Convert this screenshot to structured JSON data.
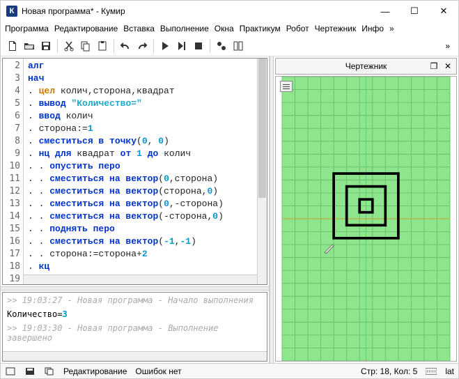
{
  "window": {
    "title": "Новая программа* - Кумир",
    "icon_letter": "К"
  },
  "menu": {
    "items": [
      "Программа",
      "Редактирование",
      "Вставка",
      "Выполнение",
      "Окна",
      "Практикум",
      "Робот",
      "Чертежник",
      "Инфо",
      "»"
    ]
  },
  "toolbar": {
    "more": "»"
  },
  "editor": {
    "first_line": 2,
    "lines": [
      {
        "n": 2,
        "seg": [
          {
            "t": "алг",
            "c": "kw"
          }
        ]
      },
      {
        "n": 3,
        "seg": [
          {
            "t": "нач",
            "c": "kw"
          }
        ]
      },
      {
        "n": 4,
        "seg": [
          {
            "t": ". ",
            "c": "id"
          },
          {
            "t": "цел",
            "c": "ty"
          },
          {
            "t": " колич,сторона,квадрат",
            "c": "id"
          }
        ]
      },
      {
        "n": 5,
        "seg": [
          {
            "t": ". ",
            "c": "id"
          },
          {
            "t": "вывод",
            "c": "kw"
          },
          {
            "t": " ",
            "c": "id"
          },
          {
            "t": "\"Количество=\"",
            "c": "str"
          }
        ]
      },
      {
        "n": 6,
        "seg": [
          {
            "t": ". ",
            "c": "id"
          },
          {
            "t": "ввод",
            "c": "kw"
          },
          {
            "t": " колич",
            "c": "id"
          }
        ]
      },
      {
        "n": 7,
        "seg": [
          {
            "t": ". сторона:=",
            "c": "id"
          },
          {
            "t": "1",
            "c": "num"
          }
        ]
      },
      {
        "n": 8,
        "seg": [
          {
            "t": ". ",
            "c": "id"
          },
          {
            "t": "сместиться в точку",
            "c": "kw"
          },
          {
            "t": "(",
            "c": "id"
          },
          {
            "t": "0",
            "c": "num"
          },
          {
            "t": ", ",
            "c": "id"
          },
          {
            "t": "0",
            "c": "num"
          },
          {
            "t": ")",
            "c": "id"
          }
        ]
      },
      {
        "n": 9,
        "seg": [
          {
            "t": ". ",
            "c": "id"
          },
          {
            "t": "нц для",
            "c": "kw"
          },
          {
            "t": " квадрат ",
            "c": "id"
          },
          {
            "t": "от",
            "c": "kw"
          },
          {
            "t": " ",
            "c": "id"
          },
          {
            "t": "1",
            "c": "num"
          },
          {
            "t": " ",
            "c": "id"
          },
          {
            "t": "до",
            "c": "kw"
          },
          {
            "t": " колич",
            "c": "id"
          }
        ]
      },
      {
        "n": 10,
        "seg": [
          {
            "t": ". . ",
            "c": "id"
          },
          {
            "t": "опустить перо",
            "c": "kw"
          }
        ]
      },
      {
        "n": 11,
        "seg": [
          {
            "t": ". . ",
            "c": "id"
          },
          {
            "t": "сместиться на вектор",
            "c": "kw"
          },
          {
            "t": "(",
            "c": "id"
          },
          {
            "t": "0",
            "c": "num"
          },
          {
            "t": ",сторона)",
            "c": "id"
          }
        ]
      },
      {
        "n": 12,
        "seg": [
          {
            "t": ". . ",
            "c": "id"
          },
          {
            "t": "сместиться на вектор",
            "c": "kw"
          },
          {
            "t": "(сторона,",
            "c": "id"
          },
          {
            "t": "0",
            "c": "num"
          },
          {
            "t": ")",
            "c": "id"
          }
        ]
      },
      {
        "n": 13,
        "seg": [
          {
            "t": ". . ",
            "c": "id"
          },
          {
            "t": "сместиться на вектор",
            "c": "kw"
          },
          {
            "t": "(",
            "c": "id"
          },
          {
            "t": "0",
            "c": "num"
          },
          {
            "t": ",-сторона)",
            "c": "id"
          }
        ]
      },
      {
        "n": 14,
        "seg": [
          {
            "t": ". . ",
            "c": "id"
          },
          {
            "t": "сместиться на вектор",
            "c": "kw"
          },
          {
            "t": "(-сторона,",
            "c": "id"
          },
          {
            "t": "0",
            "c": "num"
          },
          {
            "t": ")",
            "c": "id"
          }
        ]
      },
      {
        "n": 15,
        "seg": [
          {
            "t": ". . ",
            "c": "id"
          },
          {
            "t": "поднять перо",
            "c": "kw"
          }
        ]
      },
      {
        "n": 16,
        "seg": [
          {
            "t": ". . ",
            "c": "id"
          },
          {
            "t": "сместиться на вектор",
            "c": "kw"
          },
          {
            "t": "(",
            "c": "id"
          },
          {
            "t": "-1",
            "c": "num"
          },
          {
            "t": ",",
            "c": "id"
          },
          {
            "t": "-1",
            "c": "num"
          },
          {
            "t": ")",
            "c": "id"
          }
        ]
      },
      {
        "n": 17,
        "seg": [
          {
            "t": ". . сторона:=сторона+",
            "c": "id"
          },
          {
            "t": "2",
            "c": "num"
          }
        ]
      },
      {
        "n": 18,
        "seg": [
          {
            "t": ". ",
            "c": "id"
          },
          {
            "t": "кц",
            "c": "kw"
          }
        ]
      },
      {
        "n": 19,
        "seg": [
          {
            "t": "ко",
            "c": "kw"
          }
        ]
      }
    ]
  },
  "console": {
    "line1": ">> 19:03:27 - Новая программа - Начало выполнения",
    "prompt": "Количество=",
    "value": "3",
    "line2": ">> 19:03:30 - Новая программа - Выполнение завершено"
  },
  "panel": {
    "title": "Чертежник"
  },
  "status": {
    "mode": "Редактирование",
    "errors": "Ошибок нет",
    "pos": "Стр: 18, Кол: 5",
    "lang": "lat"
  }
}
